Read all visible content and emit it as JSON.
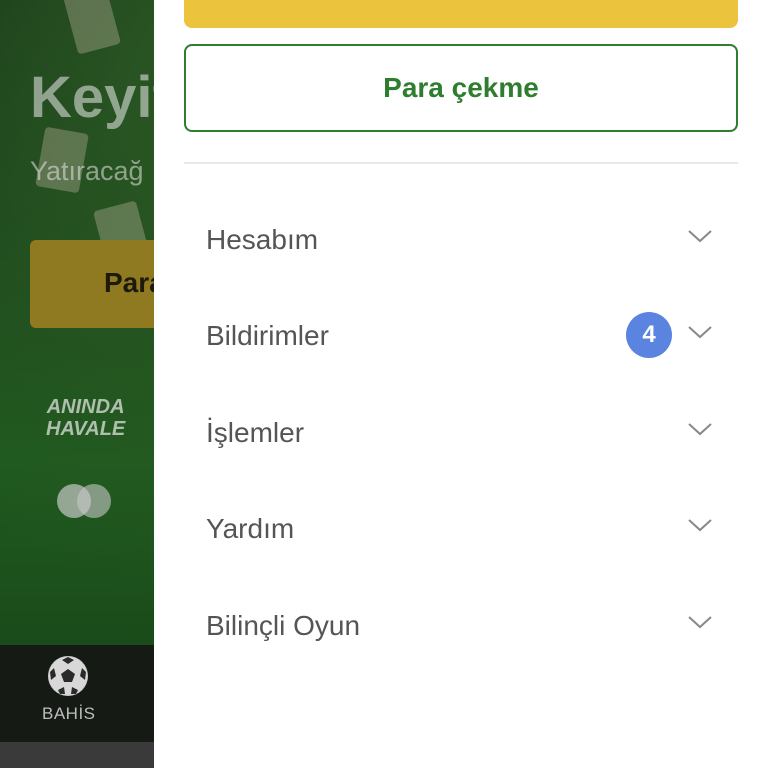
{
  "background": {
    "hero_title": "Keyif",
    "hero_subtitle": "Yatıracağ",
    "deposit_button_label": "Para",
    "payment_methods": {
      "havale_line1": "ANINDA",
      "havale_line2": "HAVALE"
    },
    "bottom_nav": {
      "item_label": "BAHİS"
    }
  },
  "drawer": {
    "withdraw_button_label": "Para çekme",
    "menu": [
      {
        "label": "Hesabım"
      },
      {
        "label": "Bildirimler",
        "badge": "4"
      },
      {
        "label": "İşlemler"
      },
      {
        "label": "Yardım"
      },
      {
        "label": "Bilinçli Oyun"
      }
    ]
  },
  "colors": {
    "accent_green": "#2f7d2f",
    "accent_yellow": "#ebc33c",
    "badge_blue": "#5b84e0"
  }
}
